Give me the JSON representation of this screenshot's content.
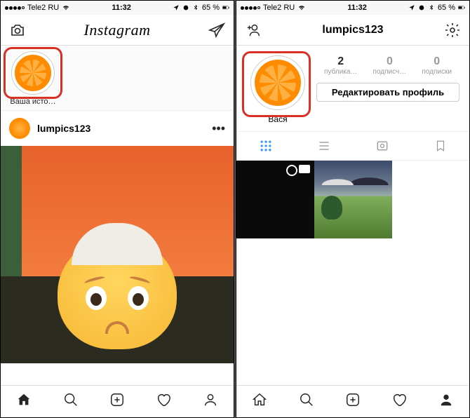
{
  "status_bar": {
    "carrier": "Tele2 RU",
    "time": "11:32",
    "battery_pct": "65 %"
  },
  "left_screen": {
    "app_title": "Instagram",
    "story_label": "Ваша исто…",
    "feed_username": "lumpics123",
    "feed_more": "•••"
  },
  "right_screen": {
    "profile_username": "lumpics123",
    "profile_display_name": "Вася",
    "stats": {
      "posts": {
        "count": "2",
        "label": "публика…"
      },
      "followers": {
        "count": "0",
        "label": "подписч…"
      },
      "following": {
        "count": "0",
        "label": "подписки"
      }
    },
    "edit_profile_label": "Редактировать профиль"
  }
}
